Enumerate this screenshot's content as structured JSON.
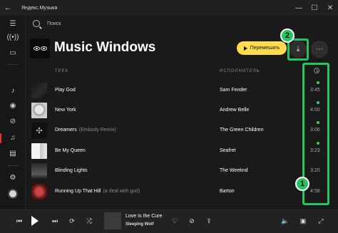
{
  "window": {
    "title": "Яндекс.Музыка",
    "back_glyph": "←",
    "minimize_glyph": "—",
    "maximize_glyph": "☐",
    "close_glyph": "✕"
  },
  "search": {
    "placeholder": "Поиск"
  },
  "rail": {
    "icons": [
      "menu-icon",
      "radio-wave-icon",
      "tv-icon",
      "music-note-icon",
      "disc-icon",
      "compass-icon",
      "playlist-icon",
      "library-icon",
      "settings-icon",
      "avatar"
    ]
  },
  "playlist": {
    "title": "Music Windows",
    "shuffle_label": "Перемешать",
    "download_glyph": "⤓",
    "more_glyph": "⋯"
  },
  "annotations": {
    "badge_download": "2",
    "badge_duration_column": "1",
    "accent": "#22c55e"
  },
  "columns": {
    "track": "ТРЕК",
    "artist": "ИСПОЛНИТЕЛЬ"
  },
  "tracks": [
    {
      "title": "Play God",
      "version": "",
      "artist": "Sam Fender",
      "duration": "3:45"
    },
    {
      "title": "New York",
      "version": "",
      "artist": "Andrew Belle",
      "duration": "4:00"
    },
    {
      "title": "Dreamers",
      "version": "(Embody Remix)",
      "artist": "The Green Children",
      "duration": "3:06"
    },
    {
      "title": "Be My Queen",
      "version": "",
      "artist": "Seafret",
      "duration": "3:23"
    },
    {
      "title": "Blinding Lights",
      "version": "",
      "artist": "The Weeknd",
      "duration": "3:20"
    },
    {
      "title": "Running Up That Hill",
      "version": "(a deal with god)",
      "artist": "Barton",
      "duration": "4:58"
    }
  ],
  "player": {
    "now_playing_title": "Love Is the Cure",
    "now_playing_artist": "Sleeping Wolf",
    "prev_glyph": "⏮",
    "next_glyph": "⏭",
    "repeat_glyph": "⟳",
    "shuffle_glyph": "⤮",
    "like_glyph": "♡",
    "dislike_glyph": "⊘",
    "share_glyph": "⇪",
    "volume_glyph": "🔈",
    "miniplayer_glyph": "▣",
    "fullscreen_glyph": "⤢"
  },
  "colors": {
    "accent_yellow": "#ffdb4d",
    "saved_dot": "#3ccf5b"
  }
}
